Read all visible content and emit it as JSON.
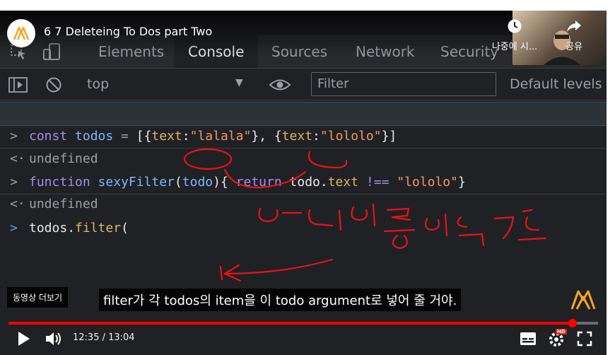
{
  "video": {
    "title": "6 7 Deleteing To Dos part Two",
    "current_time": "12:35",
    "duration": "13:04",
    "time_display": "12:35 / 13:04",
    "progress": 0.9617,
    "more_videos_label": "동영상 더보기",
    "watch_later_label": "나중에 시...",
    "share_label": "공유",
    "subtitle": "filter가 각 todos의 item을 이 todo argument로 넣어 줄 거야.",
    "hd_badge": "HD"
  },
  "devtools": {
    "tabs": [
      "Elements",
      "Console",
      "Sources",
      "Network",
      "Security"
    ],
    "active_tab": "Console",
    "context": "top",
    "filter_placeholder": "Filter",
    "levels_label": "Default levels"
  },
  "console": {
    "line1": {
      "kw": "const ",
      "var": "todos",
      "eq": " = ",
      "b1": "[{",
      "p1": "text",
      "c1": ":",
      "s1": "\"lalala\"",
      "m": "}, {",
      "p2": "text",
      "c2": ":",
      "s2": "\"lololo\"",
      "b2": "}]"
    },
    "line2": "undefined",
    "line3": {
      "kw": "function ",
      "name": "sexyFilter",
      "paren_open": "(",
      "param": "todo",
      "paren_close": ")",
      "brace": "{ ",
      "ret": "return ",
      "obj": "todo",
      "dot": ".",
      "prop": "text",
      "op": " !== ",
      "str": "\"lololo\"",
      "end": "}"
    },
    "line4": "undefined",
    "line5": {
      "obj": "todos",
      "dot": ".",
      "method": "filter",
      "paren": "("
    }
  },
  "colors": {
    "accent": "#ff0000",
    "logo": "#f5a623"
  }
}
